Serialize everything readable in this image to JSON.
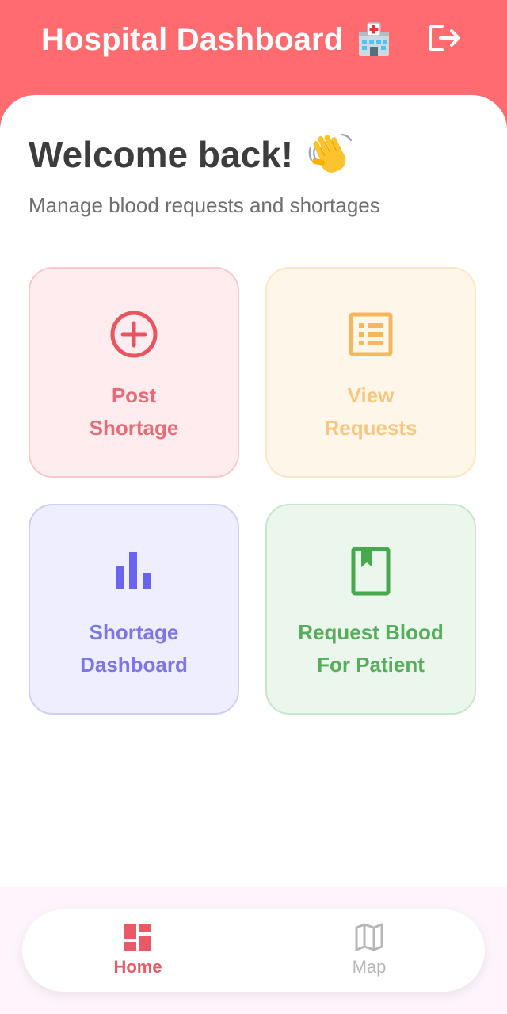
{
  "app_bar": {
    "title": "Hospital Dashboard",
    "title_icon": "hospital-emoji-icon",
    "logout_icon": "logout-icon",
    "background_color": "#ff6b6e"
  },
  "main": {
    "welcome_title": "Welcome back!",
    "welcome_icon": "waving-hand-emoji-icon",
    "subtitle": "Manage blood requests and shortages"
  },
  "cards": [
    {
      "icon": "add-circle-icon",
      "line1": "Post",
      "line2": "Shortage",
      "color": "#e86c78"
    },
    {
      "icon": "list-alt-icon",
      "line1": "View",
      "line2": "Requests",
      "color": "#f7c77f"
    },
    {
      "icon": "bar-chart-icon",
      "line1": "Shortage",
      "line2": "Dashboard",
      "color": "#7c76e6"
    },
    {
      "icon": "book-icon",
      "line1": "Request Blood",
      "line2": "For Patient",
      "color": "#57ad5b"
    }
  ],
  "bottom_nav": {
    "items": [
      {
        "label": "Home",
        "icon": "dashboard-icon",
        "selected": true
      },
      {
        "label": "Map",
        "icon": "map-icon",
        "selected": false
      }
    ],
    "active_color": "#ea5a66",
    "inactive_color": "#b7b7b7"
  }
}
